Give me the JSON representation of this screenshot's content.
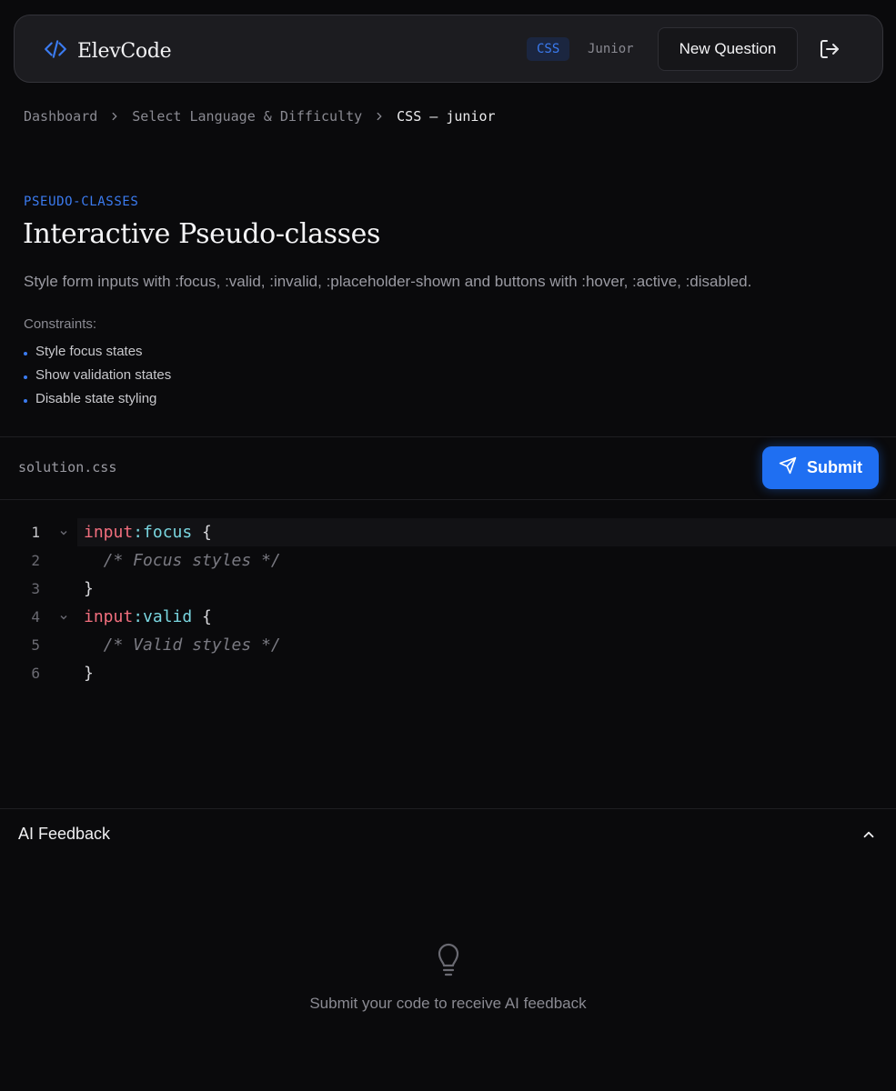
{
  "header": {
    "app_name": "ElevCode",
    "language_badge": "CSS",
    "level_badge": "Junior",
    "new_question_label": "New Question"
  },
  "breadcrumb": {
    "items": [
      "Dashboard",
      "Select Language & Difficulty"
    ],
    "current": "CSS — junior"
  },
  "question": {
    "category": "PSEUDO-CLASSES",
    "title": "Interactive Pseudo-classes",
    "description": "Style form inputs with :focus, :valid, :invalid, :placeholder-shown and buttons with :hover, :active, :disabled.",
    "constraints_label": "Constraints:",
    "constraints": [
      "Style focus states",
      "Show validation states",
      "Disable state styling"
    ]
  },
  "editor": {
    "file_name": "solution.css",
    "submit_label": "Submit",
    "lines": [
      {
        "num": "1",
        "selector": "input",
        "pseudo": ":focus",
        "punc": " {",
        "comment": ""
      },
      {
        "num": "2",
        "selector": "",
        "pseudo": "",
        "punc": "",
        "comment": "  /* Focus styles */"
      },
      {
        "num": "3",
        "selector": "",
        "pseudo": "",
        "punc": "}",
        "comment": ""
      },
      {
        "num": "4",
        "selector": "input",
        "pseudo": ":valid",
        "punc": " {",
        "comment": ""
      },
      {
        "num": "5",
        "selector": "",
        "pseudo": "",
        "punc": "",
        "comment": "  /* Valid styles */"
      },
      {
        "num": "6",
        "selector": "",
        "pseudo": "",
        "punc": "}",
        "comment": ""
      }
    ]
  },
  "feedback": {
    "title": "AI Feedback",
    "empty_message": "Submit your code to receive AI feedback"
  },
  "icons": {
    "logo": "code-brackets-icon",
    "logout": "logout-icon",
    "submit": "send-icon",
    "collapse": "chevron-up-icon",
    "empty": "lightbulb-icon"
  },
  "colors": {
    "accent": "#1f6ff2",
    "selector": "#f26f7e",
    "pseudo": "#7ad6e0",
    "comment": "#7a7a82"
  }
}
